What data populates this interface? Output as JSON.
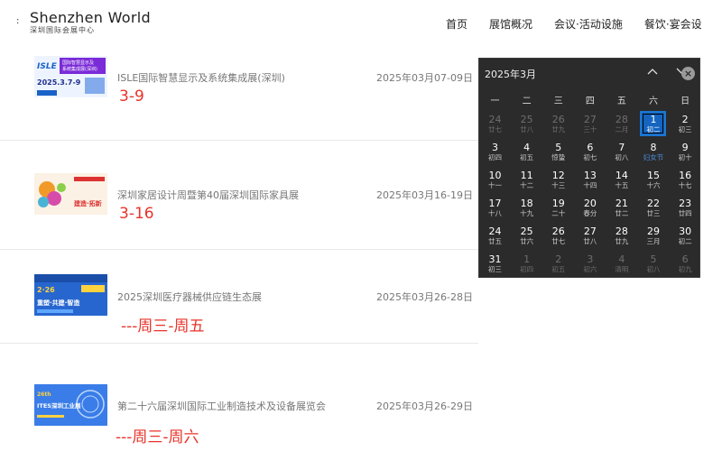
{
  "header": {
    "logo_en": "Shenzhen World",
    "logo_cn": "深圳国际会展中心",
    "nav": [
      "首页",
      "展馆概况",
      "会议·活动设施",
      "餐饮·宴会设"
    ]
  },
  "events": [
    {
      "title": "ISLE国际智慧显示及系统集成展(深圳)",
      "date": "2025年03月07-09日",
      "note": "3-9",
      "thumb": {
        "brand": "ISLE",
        "line1": "国际智慧显示及",
        "line2": "系统集成展(深圳)",
        "date_text": "2025.3.7-9"
      }
    },
    {
      "title": "深圳家居设计周暨第40届深圳国际家具展",
      "date": "2025年03月16-19日",
      "note": "3-16",
      "thumb": {
        "brand": "SIFF",
        "line1": "建造·拓新",
        "line2": "",
        "date_text": ""
      }
    },
    {
      "title": "2025深圳医疗器械供应链生态展",
      "date": "2025年03月26-28日",
      "note": "---周三-周五",
      "thumb": {
        "brand": "MEDICAL",
        "line1": "重塑·共建·智造",
        "line2": "",
        "date_text": "2.26"
      }
    },
    {
      "title": "第二十六届深圳国际工业制造技术及设备展览会",
      "date": "2025年03月26-29日",
      "note": "---周三-周六",
      "thumb": {
        "brand": "ITES",
        "line1": "ITES深圳工业展",
        "line2": "",
        "date_text": ""
      }
    }
  ],
  "calendar": {
    "month_label": "2025年3月",
    "weekdays": [
      "一",
      "二",
      "三",
      "四",
      "五",
      "六",
      "日"
    ],
    "weeks": [
      [
        {
          "d": "24",
          "l": "廿七",
          "m": true
        },
        {
          "d": "25",
          "l": "廿八",
          "m": true
        },
        {
          "d": "26",
          "l": "廿九",
          "m": true
        },
        {
          "d": "27",
          "l": "三十",
          "m": true
        },
        {
          "d": "28",
          "l": "二月",
          "m": true
        },
        {
          "d": "1",
          "l": "初二",
          "today": true
        },
        {
          "d": "2",
          "l": "初三"
        }
      ],
      [
        {
          "d": "3",
          "l": "初四"
        },
        {
          "d": "4",
          "l": "初五"
        },
        {
          "d": "5",
          "l": "惊蛰"
        },
        {
          "d": "6",
          "l": "初七"
        },
        {
          "d": "7",
          "l": "初八"
        },
        {
          "d": "8",
          "l": "妇女节",
          "blue": true
        },
        {
          "d": "9",
          "l": "初十"
        }
      ],
      [
        {
          "d": "10",
          "l": "十一"
        },
        {
          "d": "11",
          "l": "十二"
        },
        {
          "d": "12",
          "l": "十三"
        },
        {
          "d": "13",
          "l": "十四"
        },
        {
          "d": "14",
          "l": "十五"
        },
        {
          "d": "15",
          "l": "十六"
        },
        {
          "d": "16",
          "l": "十七"
        }
      ],
      [
        {
          "d": "17",
          "l": "十八"
        },
        {
          "d": "18",
          "l": "十九"
        },
        {
          "d": "19",
          "l": "二十"
        },
        {
          "d": "20",
          "l": "春分"
        },
        {
          "d": "21",
          "l": "廿二"
        },
        {
          "d": "22",
          "l": "廿三"
        },
        {
          "d": "23",
          "l": "廿四"
        }
      ],
      [
        {
          "d": "24",
          "l": "廿五"
        },
        {
          "d": "25",
          "l": "廿六"
        },
        {
          "d": "26",
          "l": "廿七"
        },
        {
          "d": "27",
          "l": "廿八"
        },
        {
          "d": "28",
          "l": "廿九"
        },
        {
          "d": "29",
          "l": "三月"
        },
        {
          "d": "30",
          "l": "初二"
        }
      ],
      [
        {
          "d": "31",
          "l": "初三"
        },
        {
          "d": "1",
          "l": "初四",
          "m": true
        },
        {
          "d": "2",
          "l": "初五",
          "m": true
        },
        {
          "d": "3",
          "l": "初六",
          "m": true
        },
        {
          "d": "4",
          "l": "清明",
          "m": true
        },
        {
          "d": "5",
          "l": "初八",
          "m": true
        },
        {
          "d": "6",
          "l": "初九",
          "m": true
        }
      ]
    ]
  }
}
